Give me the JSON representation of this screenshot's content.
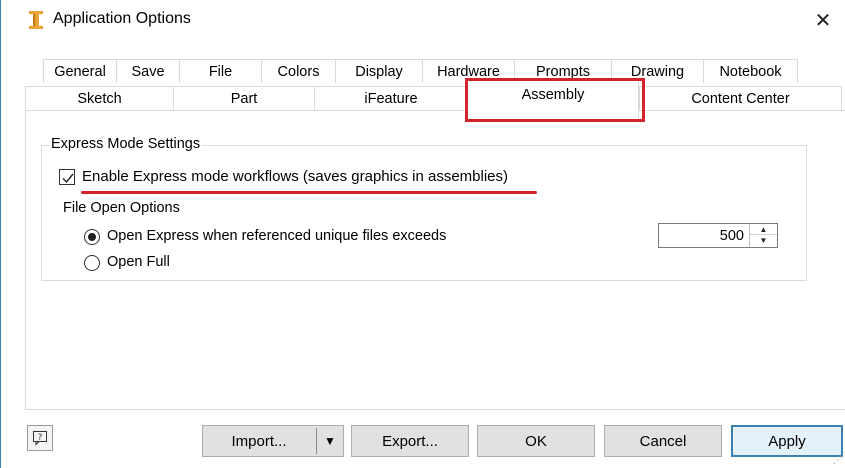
{
  "window": {
    "title": "Application Options",
    "close_glyph": "✕"
  },
  "tabs": {
    "row1": [
      "General",
      "Save",
      "File",
      "Colors",
      "Display",
      "Hardware",
      "Prompts",
      "Drawing",
      "Notebook"
    ],
    "row2": [
      "Sketch",
      "Part",
      "iFeature",
      "Content Center"
    ],
    "active": "Assembly"
  },
  "express_mode": {
    "group_title": "Express Mode Settings",
    "enable_checkbox_label": "Enable Express mode workflows (saves graphics in assemblies)",
    "enable_checked": true,
    "file_open_options_label": "File Open Options",
    "radio_express_label": "Open Express when referenced unique files exceeds",
    "radio_full_label": "Open Full",
    "selected_option": "express",
    "threshold_value": "500"
  },
  "buttons": {
    "import": "Import...",
    "export": "Export...",
    "ok": "OK",
    "cancel": "Cancel",
    "apply": "Apply"
  },
  "colors": {
    "highlight": "#d6232b",
    "accent": "#3c7fb1"
  },
  "icons": {
    "app": "inventor-app-icon",
    "help": "help-icon",
    "close": "close-icon"
  }
}
